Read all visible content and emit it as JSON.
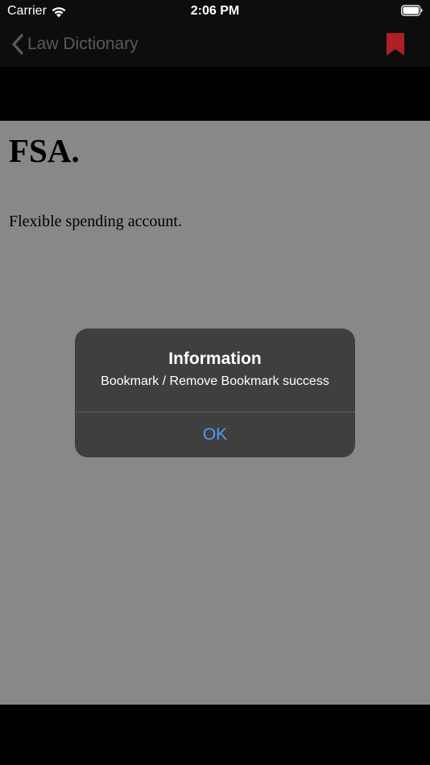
{
  "status_bar": {
    "carrier": "Carrier",
    "time": "2:06 PM",
    "icons": [
      "wifi-icon",
      "battery-icon"
    ]
  },
  "nav_bar": {
    "back_label": "Law Dictionary",
    "back_icon": "chevron-left-icon",
    "bookmark_icon": "bookmark-icon",
    "bookmark_color": "#b01f24"
  },
  "entry": {
    "term": "FSA.",
    "definition": "Flexible spending account."
  },
  "alert": {
    "title": "Information",
    "message": "Bookmark / Remove Bookmark success",
    "ok_label": "OK",
    "ok_color": "#4d9cf8"
  }
}
